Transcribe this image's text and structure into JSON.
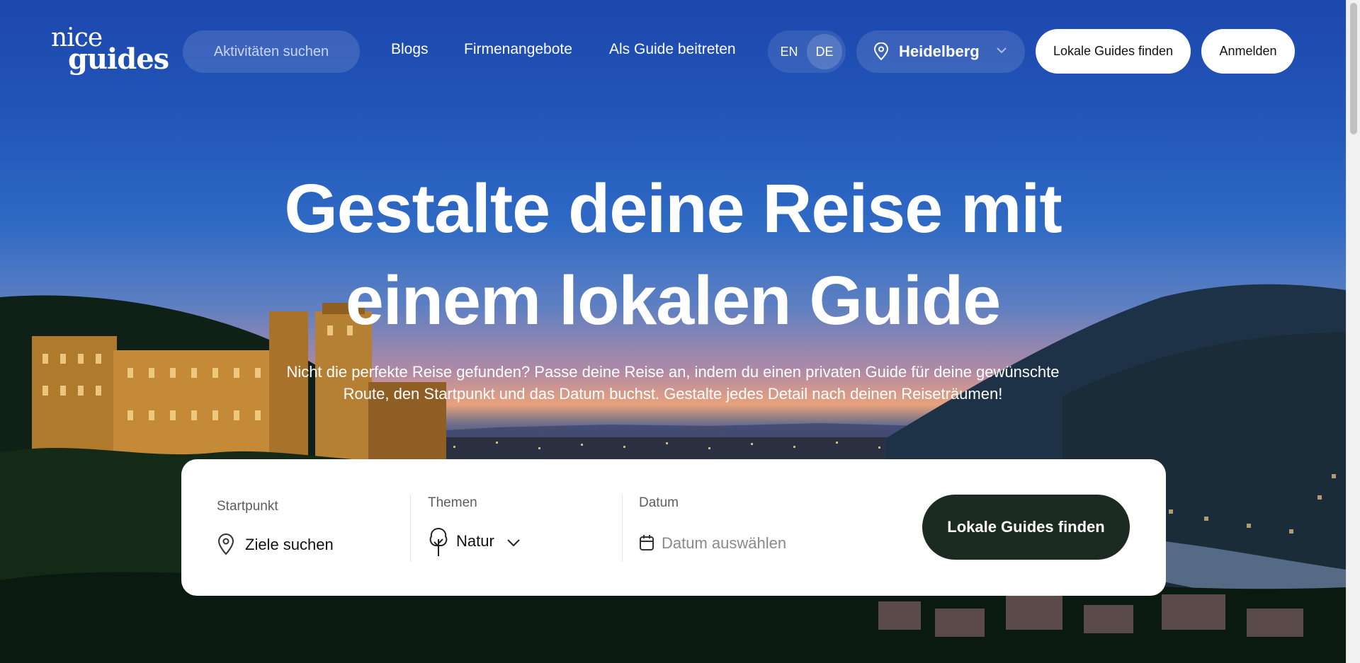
{
  "header": {
    "logo_line1": "nice",
    "logo_line2": "guides",
    "search_label": "Aktivitäten suchen",
    "nav_links": [
      "Blogs",
      "Firmenangebote",
      "Als Guide beitreten"
    ],
    "languages": [
      "EN",
      "DE"
    ],
    "selected_language": "DE",
    "city": "Heidelberg",
    "find_guides_button": "Lokale Guides finden",
    "login_button": "Anmelden"
  },
  "hero": {
    "headline_line1": "Gestalte deine Reise mit",
    "headline_line2": "einem lokalen Guide",
    "subtext_line1": "Nicht die perfekte Reise gefunden? Passe deine Reise an, indem du einen privaten Guide für deine gewünschte",
    "subtext_line2": "Route, den Startpunkt und das Datum buchst. Gestalte jedes Detail nach deinen Reiseträumen!"
  },
  "search_card": {
    "start_label": "Startpunkt",
    "start_value": "Ziele suchen",
    "themes_label": "Themen",
    "themes_value": "Natur",
    "date_label": "Datum",
    "date_placeholder": "Datum auswählen",
    "submit_button": "Lokale Guides finden"
  },
  "colors": {
    "cta_background": "#1c2b22",
    "sky_top": "#1d47ad"
  },
  "icons": [
    "location-pin-icon",
    "chevron-down-icon",
    "tree-icon",
    "calendar-icon"
  ]
}
